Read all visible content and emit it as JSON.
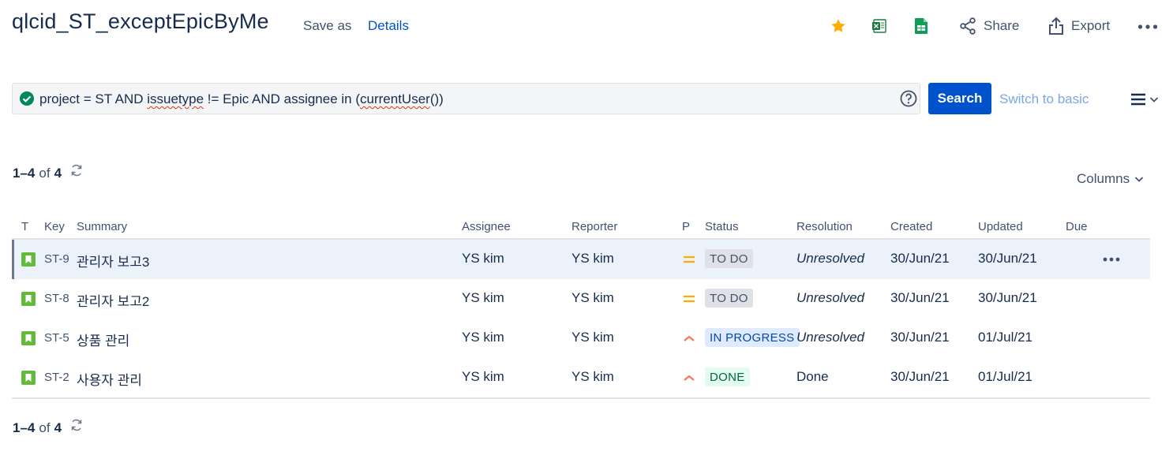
{
  "header": {
    "title": "qlcid_ST_exceptEpicByMe",
    "save_as": "Save as",
    "details": "Details",
    "share": "Share",
    "export": "Export",
    "icons": [
      "star-icon",
      "excel-icon",
      "sheets-icon",
      "share-icon",
      "export-icon",
      "more-icon"
    ]
  },
  "search": {
    "jql_prefix": "project = ST AND ",
    "jql_issuetype": "issuetype",
    "jql_middle": " != Epic AND assignee in (",
    "jql_current_user": "currentUser",
    "jql_suffix": "())",
    "button": "Search",
    "switch_basic": "Switch to basic"
  },
  "results": {
    "top": {
      "range": "1–4",
      "of": "of",
      "total": "4"
    },
    "bottom": {
      "range": "1–4",
      "of": "of",
      "total": "4"
    },
    "columns_label": "Columns"
  },
  "table": {
    "headers": {
      "type": "T",
      "key": "Key",
      "summary": "Summary",
      "assignee": "Assignee",
      "reporter": "Reporter",
      "priority": "P",
      "status": "Status",
      "resolution": "Resolution",
      "created": "Created",
      "updated": "Updated",
      "due": "Due"
    },
    "rows": [
      {
        "key": "ST-9",
        "summary": "관리자 보고3",
        "assignee": "YS kim",
        "reporter": "YS kim",
        "priority": "medium",
        "status": "TO DO",
        "resolution": "Unresolved",
        "created": "30/Jun/21",
        "updated": "30/Jun/21",
        "due": ""
      },
      {
        "key": "ST-8",
        "summary": "관리자 보고2",
        "assignee": "YS kim",
        "reporter": "YS kim",
        "priority": "medium",
        "status": "TO DO",
        "resolution": "Unresolved",
        "created": "30/Jun/21",
        "updated": "30/Jun/21",
        "due": ""
      },
      {
        "key": "ST-5",
        "summary": "상품 관리",
        "assignee": "YS kim",
        "reporter": "YS kim",
        "priority": "high",
        "status": "IN PROGRESS",
        "resolution": "Unresolved",
        "created": "30/Jun/21",
        "updated": "01/Jul/21",
        "due": ""
      },
      {
        "key": "ST-2",
        "summary": "사용자 관리",
        "assignee": "YS kim",
        "reporter": "YS kim",
        "priority": "high",
        "status": "DONE",
        "resolution": "Done",
        "created": "30/Jun/21",
        "updated": "01/Jul/21",
        "due": ""
      }
    ]
  },
  "colors": {
    "brand_blue": "#0052cc",
    "star": "#ffab00",
    "priority_medium": "#ffab00",
    "priority_high": "#ff7452",
    "story_green": "#63ba3c"
  }
}
